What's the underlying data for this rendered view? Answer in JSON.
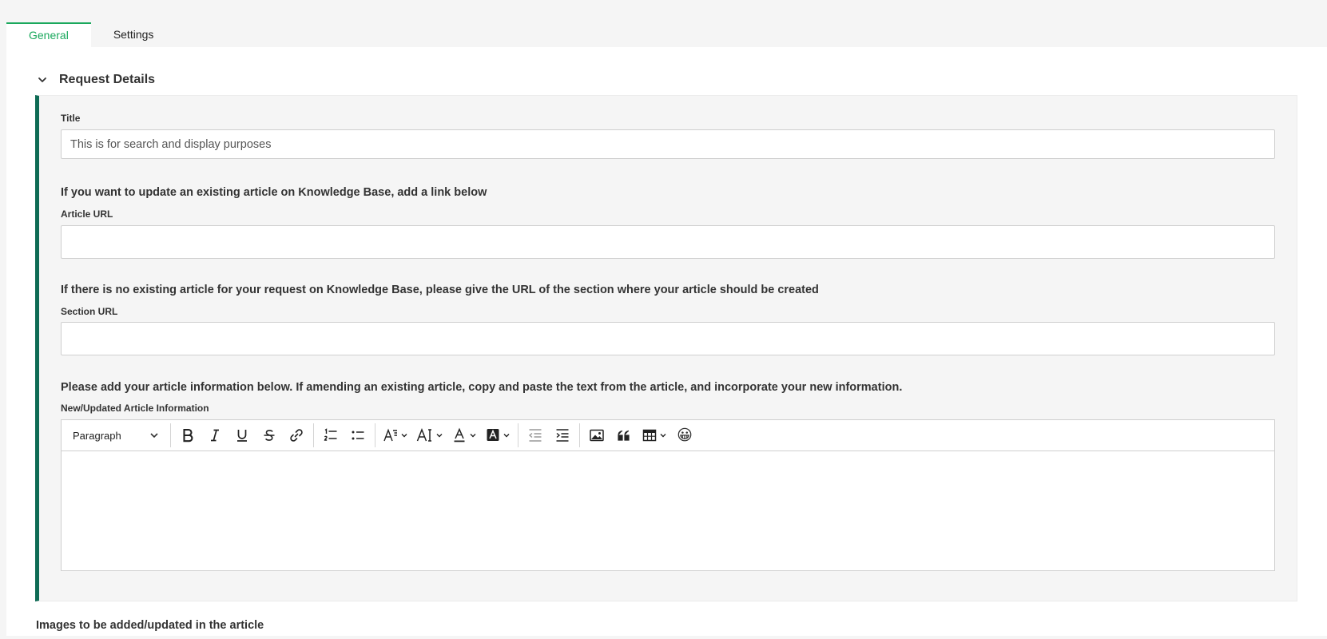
{
  "tabs": [
    {
      "label": "General",
      "active": true
    },
    {
      "label": "Settings",
      "active": false
    }
  ],
  "section": {
    "title": "Request Details"
  },
  "fields": {
    "title": {
      "label": "Title",
      "placeholder": "This is for search and display purposes",
      "value": ""
    },
    "article_hint": "If you want to update an existing article on Knowledge Base, add a link below",
    "article_url": {
      "label": "Article URL",
      "value": ""
    },
    "section_hint": "If there is no existing article for your request on Knowledge Base, please give the URL of the section where your article should be created",
    "section_url": {
      "label": "Section URL",
      "value": ""
    },
    "info_hint": "Please add your article information below. If amending an existing article, copy and paste the text from the article, and incorporate your new information.",
    "info": {
      "label": "New/Updated Article Information",
      "value": ""
    }
  },
  "editor": {
    "paragraph_select": "Paragraph",
    "emoji": "😀",
    "tools": [
      "bold-icon",
      "italic-icon",
      "underline-icon",
      "strikethrough-icon",
      "link-icon",
      "numbered-list-icon",
      "bulleted-list-icon",
      "font-family-icon",
      "font-size-icon",
      "font-color-icon",
      "highlight-icon",
      "outdent-icon",
      "indent-icon",
      "image-icon",
      "blockquote-icon",
      "table-icon",
      "emoji-icon"
    ]
  },
  "images_label": "Images to be added/updated in the article",
  "colors": {
    "accent": "#1aa85c",
    "box_border": "#0e6b55",
    "background": "#f5f5f5"
  }
}
